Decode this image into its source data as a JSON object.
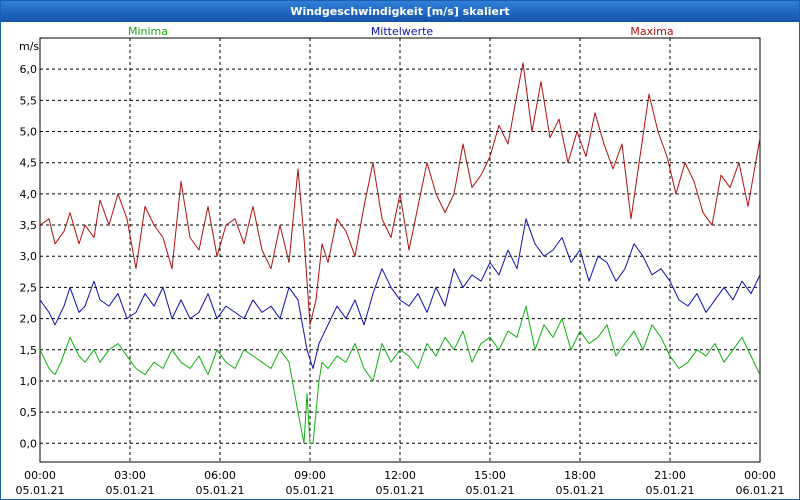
{
  "window": {
    "title": "Windgeschwindigkeit [m/s] skaliert"
  },
  "chart_data": {
    "type": "line",
    "ylabel": "m/s",
    "ylim": [
      -0.3,
      6.5
    ],
    "yticks": [
      "0,0",
      "0,5",
      "1,0",
      "1,5",
      "2,0",
      "2,5",
      "3,0",
      "3,5",
      "4,0",
      "4,5",
      "5,0",
      "5,5",
      "6,0"
    ],
    "xlim_hours": [
      0,
      24
    ],
    "xticks": [
      {
        "time": "00:00",
        "date": "05.01.21"
      },
      {
        "time": "03:00",
        "date": "05.01.21"
      },
      {
        "time": "06:00",
        "date": "05.01.21"
      },
      {
        "time": "09:00",
        "date": "05.01.21"
      },
      {
        "time": "12:00",
        "date": "05.01.21"
      },
      {
        "time": "15:00",
        "date": "05.01.21"
      },
      {
        "time": "18:00",
        "date": "05.01.21"
      },
      {
        "time": "21:00",
        "date": "05.01.21"
      },
      {
        "time": "00:00",
        "date": "06.01.21"
      }
    ],
    "grid": true,
    "series": [
      {
        "name": "Minima",
        "color": "#10b010",
        "x": [
          0.0,
          0.3,
          0.5,
          0.7,
          1.0,
          1.3,
          1.5,
          1.8,
          2.0,
          2.3,
          2.6,
          2.9,
          3.2,
          3.5,
          3.8,
          4.1,
          4.4,
          4.7,
          5.0,
          5.3,
          5.6,
          5.9,
          6.2,
          6.5,
          6.8,
          7.1,
          7.4,
          7.7,
          8.0,
          8.3,
          8.6,
          8.8,
          8.9,
          9.0,
          9.1,
          9.2,
          9.3,
          9.4,
          9.6,
          9.9,
          10.2,
          10.5,
          10.8,
          11.1,
          11.4,
          11.7,
          12.0,
          12.3,
          12.6,
          12.9,
          13.2,
          13.5,
          13.8,
          14.1,
          14.4,
          14.7,
          15.0,
          15.3,
          15.6,
          15.9,
          16.2,
          16.5,
          16.8,
          17.1,
          17.4,
          17.7,
          18.0,
          18.3,
          18.6,
          18.9,
          19.2,
          19.5,
          19.8,
          20.1,
          20.4,
          20.7,
          21.0,
          21.3,
          21.6,
          21.9,
          22.2,
          22.5,
          22.8,
          23.1,
          23.4,
          23.7,
          24.0
        ],
        "y": [
          1.5,
          1.2,
          1.1,
          1.3,
          1.7,
          1.4,
          1.3,
          1.5,
          1.3,
          1.5,
          1.6,
          1.4,
          1.2,
          1.1,
          1.3,
          1.2,
          1.5,
          1.3,
          1.2,
          1.4,
          1.1,
          1.5,
          1.3,
          1.2,
          1.5,
          1.4,
          1.3,
          1.2,
          1.5,
          1.3,
          0.5,
          0.0,
          0.8,
          0.0,
          0.0,
          0.5,
          1.0,
          1.3,
          1.2,
          1.4,
          1.3,
          1.6,
          1.2,
          1.0,
          1.6,
          1.3,
          1.5,
          1.4,
          1.2,
          1.6,
          1.4,
          1.7,
          1.5,
          1.8,
          1.3,
          1.6,
          1.7,
          1.5,
          1.8,
          1.7,
          2.2,
          1.5,
          1.9,
          1.7,
          2.0,
          1.5,
          1.8,
          1.6,
          1.7,
          1.9,
          1.4,
          1.6,
          1.8,
          1.5,
          1.9,
          1.7,
          1.4,
          1.2,
          1.3,
          1.5,
          1.4,
          1.6,
          1.3,
          1.5,
          1.7,
          1.4,
          1.1
        ]
      },
      {
        "name": "Mittelwerte",
        "color": "#1010b0",
        "x": [
          0.0,
          0.3,
          0.5,
          0.8,
          1.0,
          1.3,
          1.5,
          1.8,
          2.0,
          2.3,
          2.6,
          2.9,
          3.2,
          3.5,
          3.8,
          4.1,
          4.4,
          4.7,
          5.0,
          5.3,
          5.6,
          5.9,
          6.2,
          6.5,
          6.8,
          7.1,
          7.4,
          7.7,
          8.0,
          8.3,
          8.6,
          8.9,
          9.1,
          9.3,
          9.6,
          9.9,
          10.2,
          10.5,
          10.8,
          11.1,
          11.4,
          11.7,
          12.0,
          12.3,
          12.6,
          12.9,
          13.2,
          13.5,
          13.8,
          14.1,
          14.4,
          14.7,
          15.0,
          15.3,
          15.6,
          15.9,
          16.2,
          16.5,
          16.8,
          17.1,
          17.4,
          17.7,
          18.0,
          18.3,
          18.6,
          18.9,
          19.2,
          19.5,
          19.8,
          20.1,
          20.4,
          20.7,
          21.0,
          21.3,
          21.6,
          21.9,
          22.2,
          22.5,
          22.8,
          23.1,
          23.4,
          23.7,
          24.0
        ],
        "y": [
          2.3,
          2.1,
          1.9,
          2.2,
          2.5,
          2.1,
          2.2,
          2.6,
          2.3,
          2.2,
          2.4,
          2.0,
          2.1,
          2.4,
          2.2,
          2.5,
          2.0,
          2.3,
          2.0,
          2.1,
          2.4,
          2.0,
          2.2,
          2.1,
          2.0,
          2.3,
          2.1,
          2.2,
          2.0,
          2.5,
          2.3,
          1.5,
          1.2,
          1.6,
          1.9,
          2.2,
          2.0,
          2.3,
          1.9,
          2.4,
          2.8,
          2.5,
          2.3,
          2.2,
          2.4,
          2.1,
          2.5,
          2.2,
          2.8,
          2.5,
          2.7,
          2.6,
          2.9,
          2.7,
          3.1,
          2.8,
          3.6,
          3.2,
          3.0,
          3.1,
          3.3,
          2.9,
          3.1,
          2.6,
          3.0,
          2.9,
          2.6,
          2.8,
          3.2,
          3.0,
          2.7,
          2.8,
          2.6,
          2.3,
          2.2,
          2.4,
          2.1,
          2.3,
          2.5,
          2.3,
          2.6,
          2.4,
          2.7
        ]
      },
      {
        "name": "Maxima",
        "color": "#b01010",
        "x": [
          0.0,
          0.3,
          0.5,
          0.8,
          1.0,
          1.3,
          1.5,
          1.8,
          2.0,
          2.3,
          2.6,
          2.9,
          3.2,
          3.5,
          3.8,
          4.1,
          4.4,
          4.7,
          5.0,
          5.3,
          5.6,
          5.9,
          6.2,
          6.5,
          6.8,
          7.1,
          7.4,
          7.7,
          8.0,
          8.3,
          8.6,
          8.8,
          9.0,
          9.2,
          9.4,
          9.6,
          9.9,
          10.2,
          10.5,
          10.8,
          11.1,
          11.4,
          11.7,
          12.0,
          12.3,
          12.6,
          12.9,
          13.2,
          13.5,
          13.8,
          14.1,
          14.4,
          14.7,
          15.0,
          15.3,
          15.6,
          15.9,
          16.1,
          16.4,
          16.7,
          17.0,
          17.3,
          17.6,
          17.9,
          18.2,
          18.5,
          18.8,
          19.1,
          19.4,
          19.7,
          20.0,
          20.3,
          20.6,
          20.9,
          21.2,
          21.5,
          21.8,
          22.1,
          22.4,
          22.7,
          23.0,
          23.3,
          23.6,
          24.0
        ],
        "y": [
          3.5,
          3.6,
          3.2,
          3.4,
          3.7,
          3.2,
          3.5,
          3.3,
          3.9,
          3.5,
          4.0,
          3.6,
          2.8,
          3.8,
          3.5,
          3.3,
          2.8,
          4.2,
          3.3,
          3.1,
          3.8,
          3.0,
          3.5,
          3.6,
          3.2,
          3.8,
          3.1,
          2.8,
          3.5,
          2.9,
          4.4,
          3.3,
          1.9,
          2.3,
          3.2,
          2.9,
          3.6,
          3.4,
          3.0,
          3.8,
          4.5,
          3.6,
          3.3,
          4.0,
          3.1,
          3.8,
          4.5,
          4.0,
          3.7,
          4.0,
          4.8,
          4.1,
          4.3,
          4.6,
          5.1,
          4.8,
          5.6,
          6.1,
          5.0,
          5.8,
          4.9,
          5.2,
          4.5,
          5.0,
          4.6,
          5.3,
          4.8,
          4.4,
          4.8,
          3.6,
          4.6,
          5.6,
          5.0,
          4.6,
          4.0,
          4.5,
          4.2,
          3.7,
          3.5,
          4.3,
          4.1,
          4.5,
          3.8,
          4.9
        ]
      }
    ]
  }
}
